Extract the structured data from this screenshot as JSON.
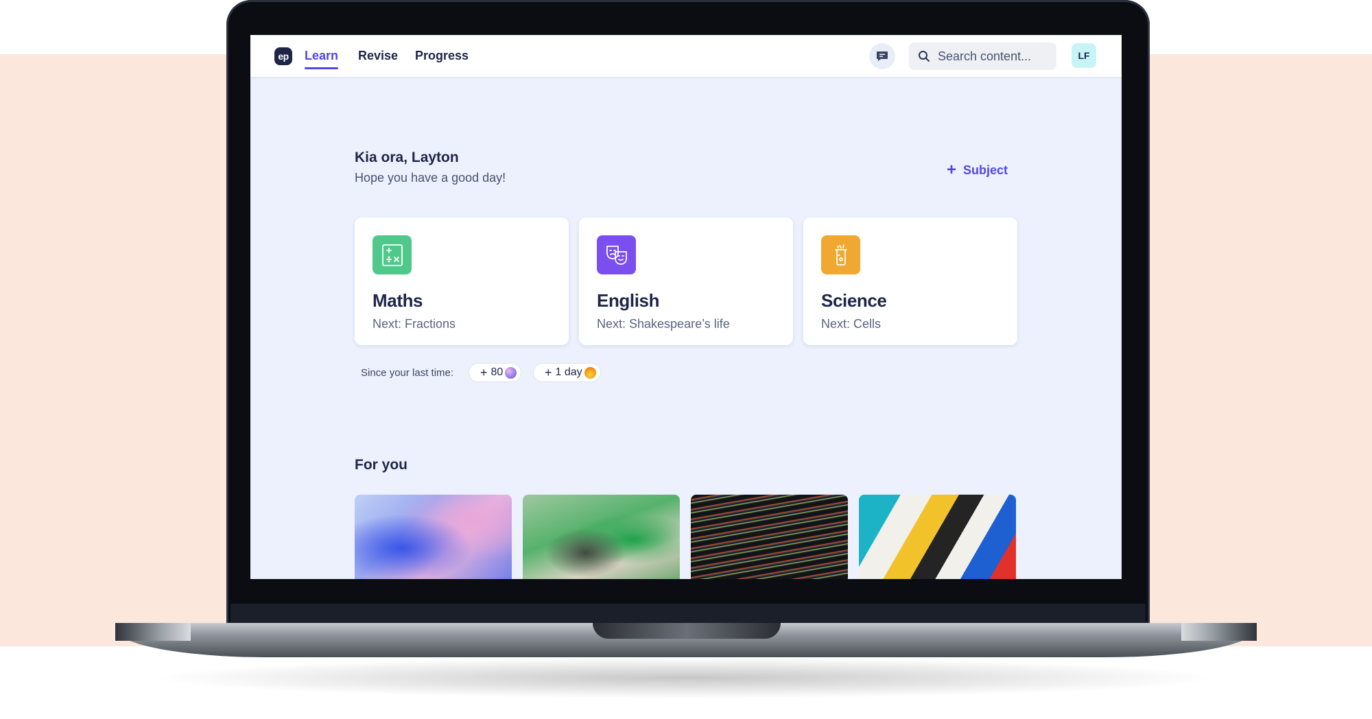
{
  "nav": {
    "logo_text": "ep",
    "links": [
      {
        "label": "Learn",
        "active": true
      },
      {
        "label": "Revise",
        "active": false
      },
      {
        "label": "Progress",
        "active": false
      }
    ],
    "search_placeholder": "Search content...",
    "avatar_initials": "LF"
  },
  "greeting": {
    "title": "Kia ora, Layton",
    "subtitle": "Hope you have a good day!",
    "add_subject_label": "Subject"
  },
  "subjects": [
    {
      "name": "Maths",
      "next": "Next: Fractions",
      "icon": "calculator-icon",
      "color": "#4fc88a"
    },
    {
      "name": "English",
      "next": "Next: Shakespeare’s life",
      "icon": "theatre-masks-icon",
      "color": "#7b4ef0"
    },
    {
      "name": "Science",
      "next": "Next: Cells",
      "icon": "beaker-icon",
      "color": "#f0a830"
    }
  ],
  "since": {
    "label": "Since your last time:",
    "pills": [
      {
        "text": "80",
        "icon": "gem-icon"
      },
      {
        "text": "1 day",
        "icon": "flame-icon"
      }
    ]
  },
  "for_you": {
    "title": "For you"
  },
  "colors": {
    "accent": "#5046e5",
    "navy": "#1e2547",
    "page_bg": "#edf1fd",
    "peach_band": "#fbe7db"
  }
}
